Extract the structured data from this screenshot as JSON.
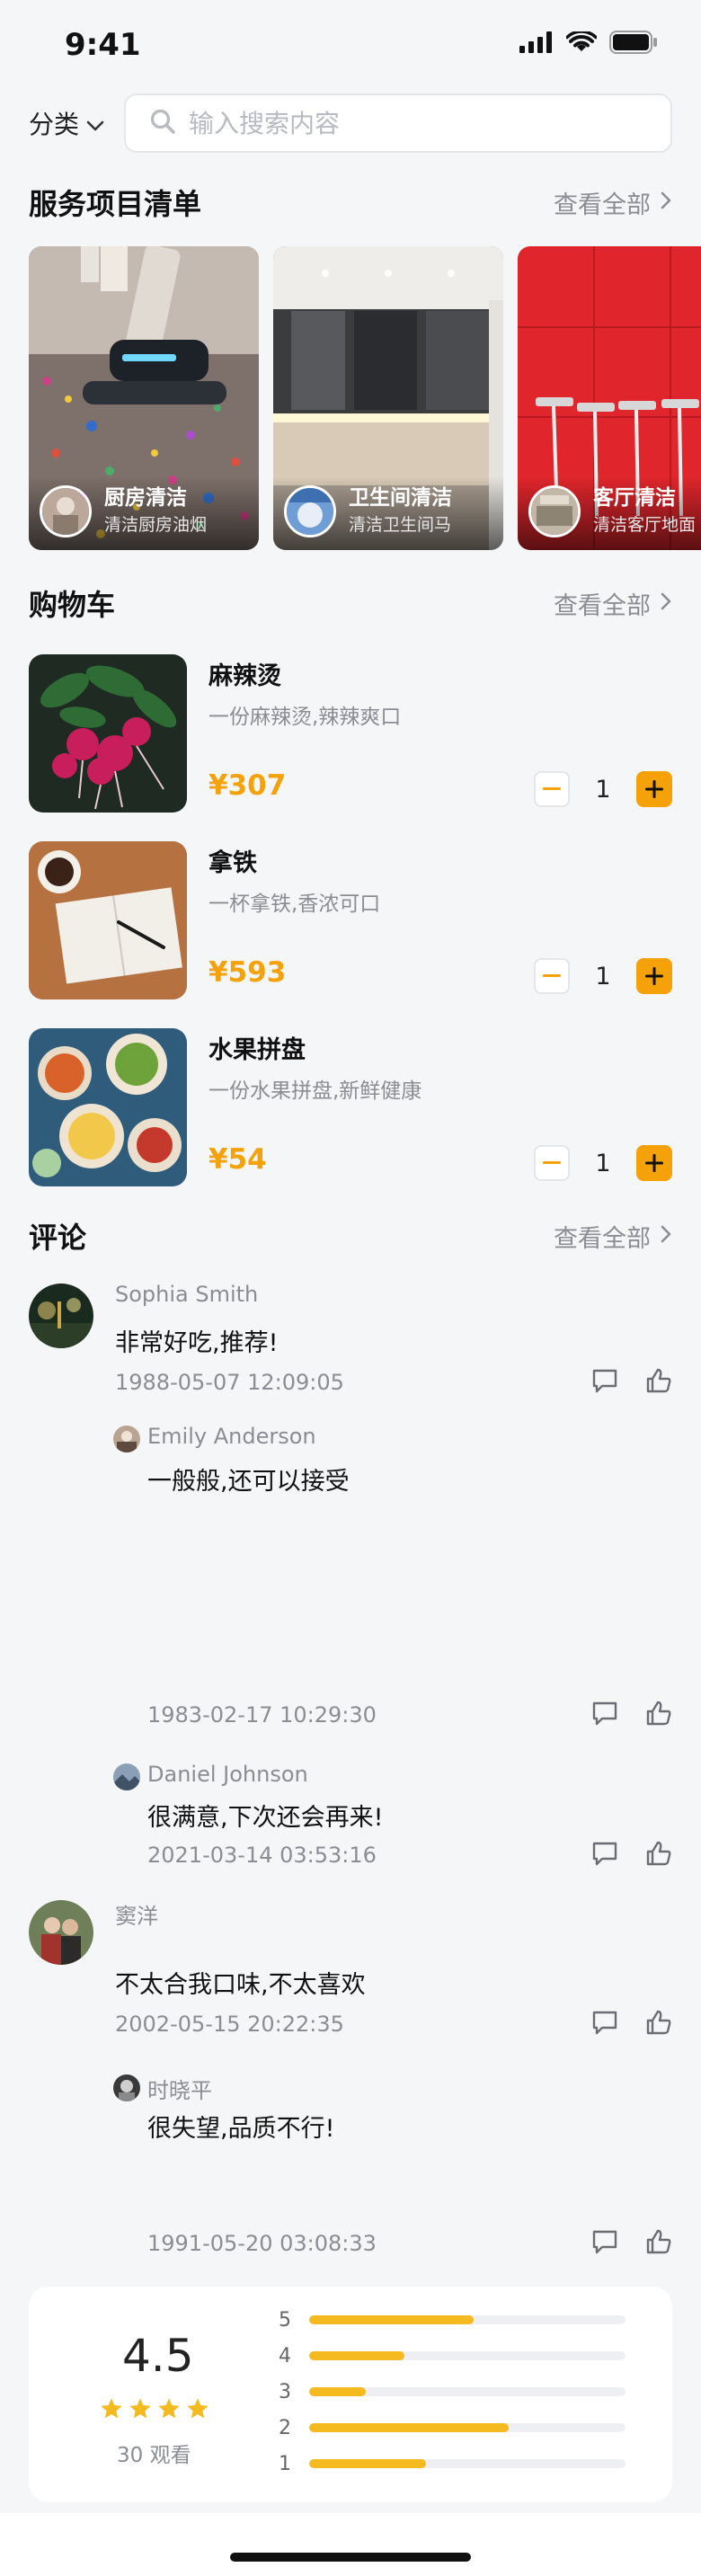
{
  "status": {
    "time": "9:41"
  },
  "search": {
    "category_label": "分类",
    "placeholder": "输入搜索内容"
  },
  "services": {
    "title": "服务项目清单",
    "see_all": "查看全部",
    "items": [
      {
        "name": "厨房清洁",
        "desc": "清洁厨房油烟"
      },
      {
        "name": "卫生间清洁",
        "desc": "清洁卫生间马"
      },
      {
        "name": "客厅清洁",
        "desc": "清洁客厅地面"
      }
    ]
  },
  "cart": {
    "title": "购物车",
    "see_all": "查看全部",
    "items": [
      {
        "name": "麻辣烫",
        "desc": "一份麻辣烫,辣辣爽口",
        "price": "¥307",
        "qty": "1"
      },
      {
        "name": "拿铁",
        "desc": "一杯拿铁,香浓可口",
        "price": "¥593",
        "qty": "1"
      },
      {
        "name": "水果拼盘",
        "desc": "一份水果拼盘,新鲜健康",
        "price": "¥54",
        "qty": "1"
      }
    ]
  },
  "comments": {
    "title": "评论",
    "see_all": "查看全部",
    "items": [
      {
        "name": "Sophia Smith",
        "text": "非常好吃,推荐!",
        "time": "1988-05-07 12:09:05"
      },
      {
        "name": "Emily Anderson",
        "text": "一般般,还可以接受",
        "time": "1983-02-17 10:29:30"
      },
      {
        "name": "Daniel Johnson",
        "text": "很满意,下次还会再来!",
        "time": "2021-03-14 03:53:16"
      },
      {
        "name": "窦洋",
        "text": "不太合我口味,不太喜欢",
        "time": "2002-05-15 20:22:35"
      },
      {
        "name": "时晓平",
        "text": "很失望,品质不行!",
        "time": "1991-05-20 03:08:33"
      }
    ]
  },
  "rating": {
    "score": "4.5",
    "stars": 4,
    "count_label": "30 观看",
    "bars": [
      {
        "label": "5",
        "fraction": 0.52
      },
      {
        "label": "4",
        "fraction": 0.3
      },
      {
        "label": "3",
        "fraction": 0.18
      },
      {
        "label": "2",
        "fraction": 0.63
      },
      {
        "label": "1",
        "fraction": 0.37
      }
    ]
  },
  "colors": {
    "accent": "#f5a20a",
    "star": "#f5ba1f",
    "muted": "#8a8d93"
  }
}
